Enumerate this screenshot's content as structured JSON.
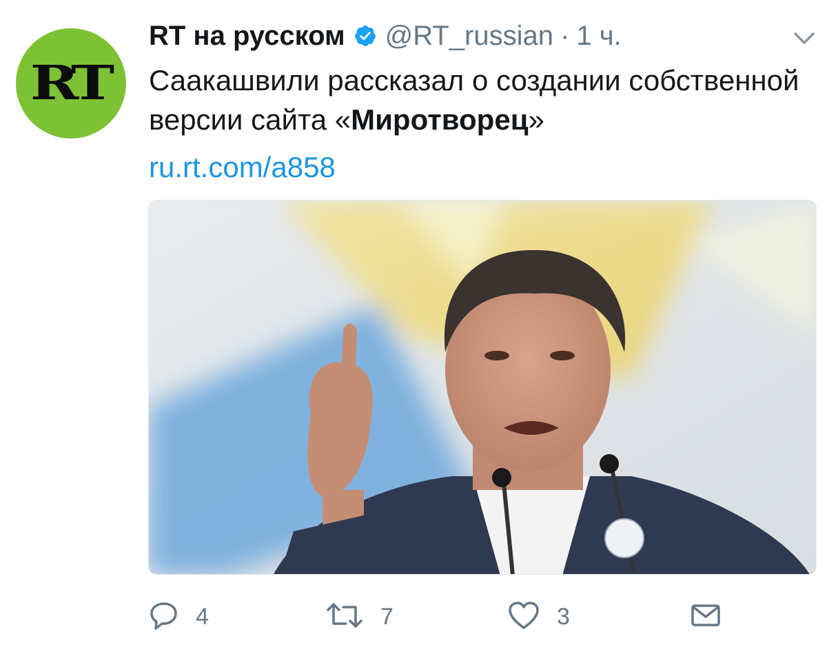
{
  "account": {
    "avatar_text": "RT",
    "display_name": "RT на русском",
    "handle": "@RT_russian",
    "separator": "·",
    "time": "1 ч."
  },
  "tweet": {
    "text_plain": "Саакашвили рассказал о создании собственной версии сайта «",
    "text_bold": "Миротворец",
    "text_close": "»",
    "link": "ru.rt.com/a858"
  },
  "actions": {
    "replies": "4",
    "retweets": "7",
    "likes": "3"
  },
  "colors": {
    "avatar_bg": "#7dc234",
    "link": "#1b95e0",
    "verified": "#1da1f2",
    "muted": "#657786"
  },
  "icons": {
    "verified": "verified-badge-icon",
    "caret": "chevron-down-icon",
    "reply": "reply-icon",
    "retweet": "retweet-icon",
    "like": "heart-icon",
    "dm": "envelope-icon"
  }
}
